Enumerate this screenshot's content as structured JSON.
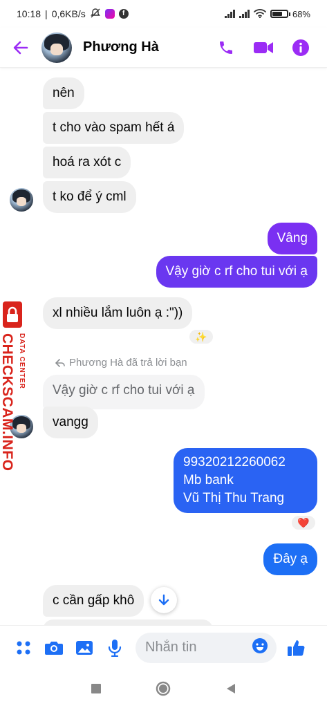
{
  "status_bar": {
    "time": "10:18",
    "network_speed": "0,6KB/s",
    "battery": "68%",
    "battery_level": 0.68,
    "icons": [
      "mute-icon",
      "app-badge-icon",
      "facebook-icon",
      "signal-icon",
      "signal-icon",
      "wifi-icon",
      "battery-icon"
    ]
  },
  "header": {
    "contact_name": "Phương Hà",
    "icons": [
      "back-arrow-icon",
      "avatar",
      "phone-icon",
      "video-camera-icon",
      "info-icon"
    ]
  },
  "colors": {
    "accent": "#9b2cf5",
    "outgoing_top": "#7a30f2",
    "outgoing_bottom": "#1d6ff5",
    "incoming": "#efefef",
    "watermark": "#d9241c"
  },
  "messages": {
    "m1": "nên",
    "m2": "t cho vào spam hết á",
    "m3": "hoá ra xót c",
    "m4": "t ko để ý cml",
    "m5": "Vâng",
    "m6": "Vậy giờ c rf cho tui với ạ",
    "m7": "xl nhiều lắm luôn ạ :\"))",
    "m7_reaction": "✨",
    "reply_note": "Phương Hà đã trả lời bạn",
    "reply_quote": "Vậy giờ c rf cho tui với ạ",
    "m8": "vangg",
    "m9_line1": "99320212260062",
    "m9_line2": "Mb bank",
    "m9_line3": "Vũ Thị Thu Trang",
    "m9_reaction": "❤️",
    "m10": "Đây ạ",
    "m11": "c cần gấp khô"
  },
  "watermark": {
    "main": "CHECKSCAM.INFO",
    "sub": "DATA CENTER"
  },
  "composer": {
    "placeholder": "Nhắn tin",
    "icons": [
      "menu-dots-icon",
      "camera-icon",
      "gallery-icon",
      "microphone-icon",
      "emoji-icon",
      "like-thumb-icon"
    ]
  },
  "nav": {
    "icons": [
      "recent-apps-icon",
      "home-icon",
      "back-triangle-icon"
    ]
  }
}
